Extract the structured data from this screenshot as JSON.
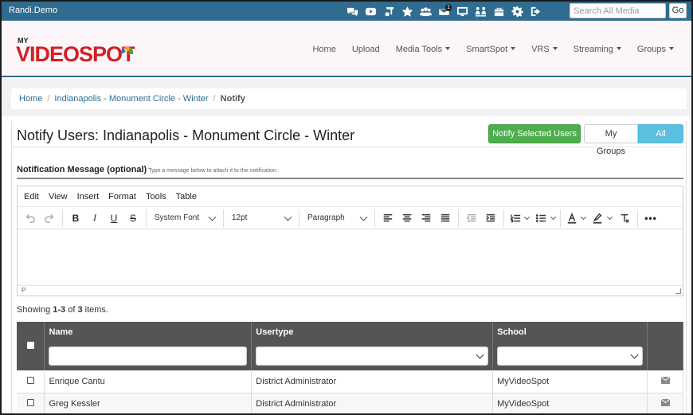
{
  "topbar": {
    "user": "Randi.Demo",
    "notification_count": "1",
    "icons": [
      "chat-icon",
      "youtube-icon",
      "music-icon",
      "star-icon",
      "users-icon",
      "mail-icon",
      "monitor-icon",
      "share-screen-icon",
      "toolbox-icon",
      "gear-icon",
      "logout-icon"
    ],
    "search_placeholder": "Search All Media",
    "go_label": "Go"
  },
  "header": {
    "logo_top": "MY",
    "logo_main": "VIDEOSPOT",
    "nav": [
      {
        "label": "Home",
        "dropdown": false
      },
      {
        "label": "Upload",
        "dropdown": false
      },
      {
        "label": "Media Tools",
        "dropdown": true
      },
      {
        "label": "SmartSpot",
        "dropdown": true
      },
      {
        "label": "VRS",
        "dropdown": true
      },
      {
        "label": "Streaming",
        "dropdown": true
      },
      {
        "label": "Groups",
        "dropdown": true
      }
    ]
  },
  "breadcrumb": {
    "items": [
      "Home",
      "Indianapolis - Monument Circle - Winter"
    ],
    "current": "Notify"
  },
  "panel": {
    "title": "Notify Users: Indianapolis - Monument Circle - Winter",
    "notify_button": "Notify Selected Users",
    "my_groups": "My Groups",
    "all_users": "All Users",
    "message_label": "Notification Message (optional)",
    "message_hint": "Type a message below to attach it to the notification."
  },
  "editor": {
    "menu": [
      "Edit",
      "View",
      "Insert",
      "Format",
      "Tools",
      "Table"
    ],
    "font_family": "System Font",
    "font_size": "12pt",
    "block_format": "Paragraph",
    "status_path": "P"
  },
  "table": {
    "showing_prefix": "Showing ",
    "showing_range": "1-3",
    "showing_of": " of ",
    "showing_total": "3",
    "showing_suffix": " items.",
    "headers": [
      "Name",
      "Usertype",
      "School"
    ],
    "rows": [
      {
        "name": "Enrique Cantu",
        "usertype": "District Administrator",
        "school": "MyVideoSpot"
      },
      {
        "name": "Greg Kessler",
        "usertype": "District Administrator",
        "school": "MyVideoSpot"
      }
    ]
  }
}
